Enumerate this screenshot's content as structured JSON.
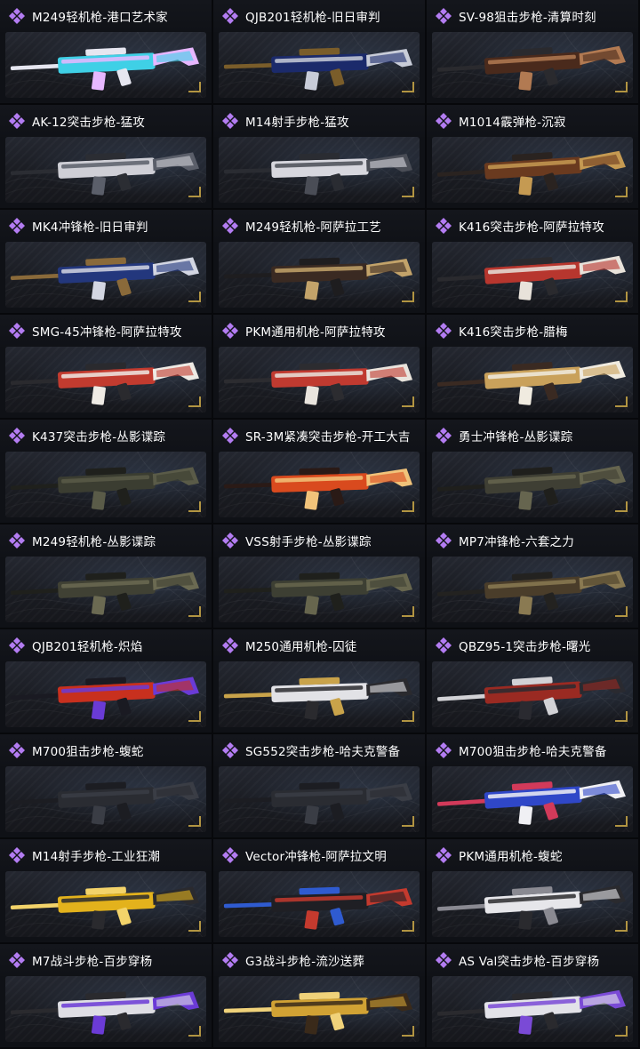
{
  "colors": {
    "background": "#0b0c10",
    "label_text": "#ffffff",
    "rarity_purple": "#b37cf2",
    "corner_accent": "#d8b34a"
  },
  "icons": {
    "rarity": "purple-diamond-cluster-icon"
  },
  "skins": [
    {
      "name": "M249轻机枪-港口艺术家",
      "colors": [
        "#3fd0e6",
        "#e7b7ff",
        "#e6e6f0"
      ]
    },
    {
      "name": "QJB201轻机枪-旧日审判",
      "colors": [
        "#1b2a6b",
        "#c8ccd8",
        "#7a5d2a"
      ]
    },
    {
      "name": "SV-98狙击步枪-清算时刻",
      "colors": [
        "#4a2a1c",
        "#b27a52",
        "#2a2a2e"
      ]
    },
    {
      "name": "AK-12突击步枪-猛攻",
      "colors": [
        "#cfcfd6",
        "#5b5f6a",
        "#2b2d33"
      ]
    },
    {
      "name": "M14射手步枪-猛攻",
      "colors": [
        "#d7d7de",
        "#4a4d56",
        "#2a2c32"
      ]
    },
    {
      "name": "M1014霰弹枪-沉寂",
      "colors": [
        "#6a3a1f",
        "#c59a52",
        "#2a2320"
      ]
    },
    {
      "name": "MK4冲锋枪-旧日审判",
      "colors": [
        "#23377d",
        "#d3d6e2",
        "#8a6a3a"
      ]
    },
    {
      "name": "M249轻机枪-阿萨拉工艺",
      "colors": [
        "#3a2a22",
        "#c3a36a",
        "#1e1d1f"
      ]
    },
    {
      "name": "K416突击步枪-阿萨拉特攻",
      "colors": [
        "#b7362e",
        "#e8e2da",
        "#2a2a2e"
      ]
    },
    {
      "name": "SMG-45冲锋枪-阿萨拉特攻",
      "colors": [
        "#c23b2f",
        "#eeeae4",
        "#2a2a2e"
      ]
    },
    {
      "name": "PKM通用机枪-阿萨拉特攻",
      "colors": [
        "#c03a30",
        "#e9e4dd",
        "#2c2c30"
      ]
    },
    {
      "name": "K416突击步枪-腊梅",
      "colors": [
        "#c9a15b",
        "#f0ebe0",
        "#3a2a22"
      ]
    },
    {
      "name": "K437突击步枪-丛影谍踪",
      "colors": [
        "#3b3d31",
        "#5a5b48",
        "#1f201c"
      ]
    },
    {
      "name": "SR-3M紧凑突击步枪-开工大吉",
      "colors": [
        "#d94a1e",
        "#f1c37a",
        "#2a1a16"
      ]
    },
    {
      "name": "勇士冲锋枪-丛影谍踪",
      "colors": [
        "#3f3f34",
        "#66654f",
        "#1f1f1c"
      ]
    },
    {
      "name": "M249轻机枪-丛影谍踪",
      "colors": [
        "#404134",
        "#6b6a52",
        "#1f201c"
      ]
    },
    {
      "name": "VSS射手步枪-丛影谍踪",
      "colors": [
        "#3d3f33",
        "#67664e",
        "#1f201c"
      ]
    },
    {
      "name": "MP7冲锋枪-六套之力",
      "colors": [
        "#4a3d2a",
        "#8a7a52",
        "#232220"
      ]
    },
    {
      "name": "QJB201轻机枪-炽焰",
      "colors": [
        "#c8301e",
        "#6a3bd6",
        "#1a1a22"
      ]
    },
    {
      "name": "M250通用机枪-囚徒",
      "colors": [
        "#e2e2e6",
        "#2a2a2e",
        "#c9a34a"
      ]
    },
    {
      "name": "QBZ95-1突击步枪-曙光",
      "colors": [
        "#9a2a22",
        "#2a2a30",
        "#d2d2d6"
      ]
    },
    {
      "name": "M700狙击步枪-蝮蛇",
      "colors": [
        "#2a2c32",
        "#3a3d45",
        "#1c1d22"
      ]
    },
    {
      "name": "SG552突击步枪-哈夫克警备",
      "colors": [
        "#2a2c32",
        "#3a3d45",
        "#1c1d22"
      ]
    },
    {
      "name": "M700狙击步枪-哈夫克警备",
      "colors": [
        "#2f47c8",
        "#f0f0f4",
        "#d23a5a"
      ]
    },
    {
      "name": "M14射手步枪-工业狂潮",
      "colors": [
        "#e3b21c",
        "#2a2a2e",
        "#f3d36a"
      ]
    },
    {
      "name": "Vector冲锋枪-阿萨拉文明",
      "colors": [
        "#1f1f24",
        "#c43a2e",
        "#2f5bd0"
      ]
    },
    {
      "name": "PKM通用机枪-蝮蛇",
      "colors": [
        "#e6e6ea",
        "#2a2a2e",
        "#8a8a92"
      ]
    },
    {
      "name": "M7战斗步枪-百步穿杨",
      "colors": [
        "#dedee4",
        "#6b3bd6",
        "#2a2a2e"
      ]
    },
    {
      "name": "G3战斗步枪-流沙送葬",
      "colors": [
        "#d1a234",
        "#3a2a1a",
        "#f0d27a"
      ]
    },
    {
      "name": "AS Val突击步枪-百步穿杨",
      "colors": [
        "#e2e2e8",
        "#7a4ad6",
        "#2a2a2e"
      ]
    }
  ]
}
